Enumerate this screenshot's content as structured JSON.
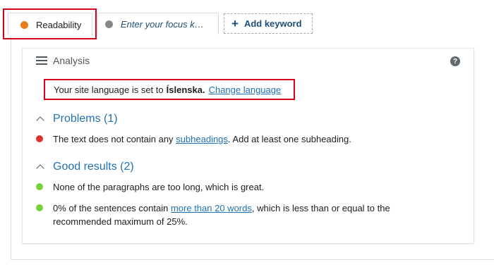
{
  "colors": {
    "readability_dot": "#ee7c1b",
    "focus_dot": "#888888",
    "bad": "#dc3232",
    "good": "#7ad03a",
    "link": "#2271b1",
    "highlight": "#d0021b"
  },
  "tabs": {
    "readability": "Readability",
    "focus_placeholder": "Enter your focus k…",
    "add_keyword_icon": "+",
    "add_keyword": "Add keyword"
  },
  "analysis": {
    "icon": "list-icon",
    "title": "Analysis",
    "help_icon": "?"
  },
  "language": {
    "prefix": "Your site language is set to",
    "language": "Íslenska.",
    "change_link": "Change language"
  },
  "problems": {
    "title": "Problems (1)",
    "items": [
      {
        "status": "bad",
        "before": "The text does not contain any",
        "link": "subheadings",
        "after": ". Add at least one subheading."
      }
    ]
  },
  "good_results": {
    "title": "Good results (2)",
    "items": [
      {
        "status": "good",
        "text": "None of the paragraphs are too long, which is great."
      },
      {
        "status": "good",
        "before": "0% of the sentences contain",
        "link": "more than 20 words",
        "after": ", which is less than or equal to the recommended maximum of 25%."
      }
    ]
  }
}
